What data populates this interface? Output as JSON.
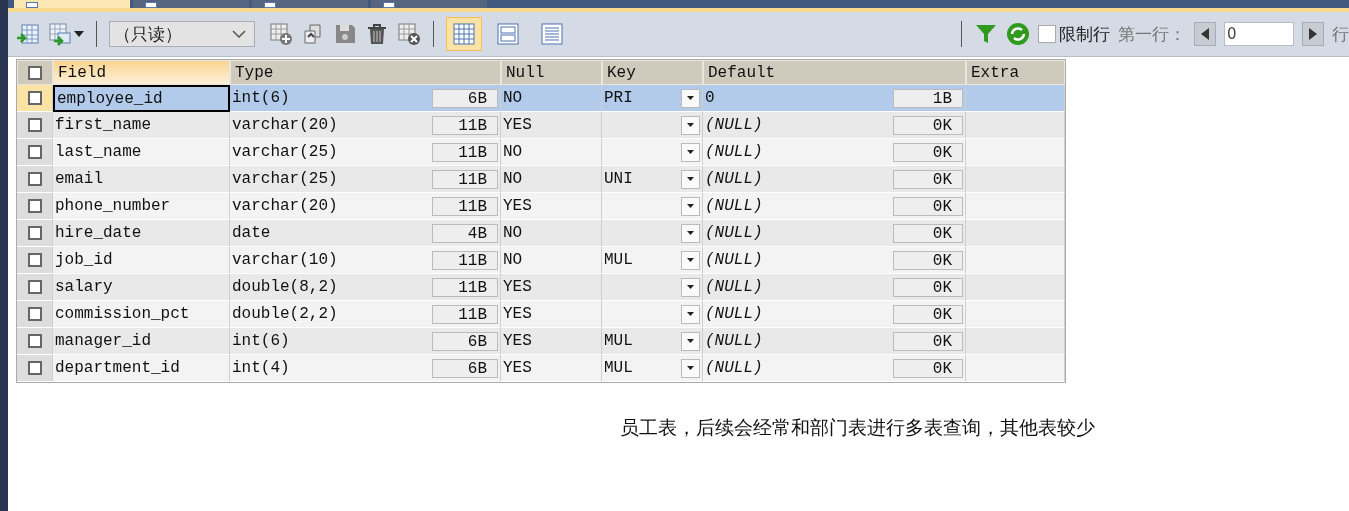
{
  "tabs": [
    {
      "selected": true
    },
    {
      "selected": false
    },
    {
      "selected": false
    },
    {
      "selected": false
    }
  ],
  "toolbar": {
    "mode_select": {
      "value": "（只读）"
    },
    "views": [
      {
        "selected": true
      },
      {
        "selected": false
      },
      {
        "selected": false
      }
    ],
    "limit_rows": {
      "label": "限制行",
      "checked": false
    },
    "first_row": {
      "label": "第一行：",
      "disabled": true,
      "value": "0"
    },
    "row_count_label": "行"
  },
  "table": {
    "select_all_checked": false,
    "columns": [
      "Field",
      "Type",
      "Null",
      "Key",
      "Default",
      "Extra"
    ],
    "rows": [
      {
        "checked": false,
        "selected": true,
        "field": "employee_id",
        "type": "int(6)",
        "type_size": "6B",
        "null": "NO",
        "key": "PRI",
        "default": "0",
        "default_is_null": false,
        "default_size": "1B"
      },
      {
        "checked": false,
        "selected": false,
        "field": "first_name",
        "type": "varchar(20)",
        "type_size": "11B",
        "null": "YES",
        "default": "(NULL)",
        "default_is_null": true,
        "default_size": "0K"
      },
      {
        "checked": false,
        "selected": false,
        "field": "last_name",
        "type": "varchar(25)",
        "type_size": "11B",
        "null": "NO",
        "default": "(NULL)",
        "default_is_null": true,
        "default_size": "0K"
      },
      {
        "checked": false,
        "selected": false,
        "field": "email",
        "type": "varchar(25)",
        "type_size": "11B",
        "null": "NO",
        "key": "UNI",
        "default": "(NULL)",
        "default_is_null": true,
        "default_size": "0K"
      },
      {
        "checked": false,
        "selected": false,
        "field": "phone_number",
        "type": "varchar(20)",
        "type_size": "11B",
        "null": "YES",
        "default": "(NULL)",
        "default_is_null": true,
        "default_size": "0K"
      },
      {
        "checked": false,
        "selected": false,
        "field": "hire_date",
        "type": "date",
        "type_size": "4B",
        "null": "NO",
        "default": "(NULL)",
        "default_is_null": true,
        "default_size": "0K"
      },
      {
        "checked": false,
        "selected": false,
        "field": "job_id",
        "type": "varchar(10)",
        "type_size": "11B",
        "null": "NO",
        "key": "MUL",
        "default": "(NULL)",
        "default_is_null": true,
        "default_size": "0K"
      },
      {
        "checked": false,
        "selected": false,
        "field": "salary",
        "type": "double(8,2)",
        "type_size": "11B",
        "null": "YES",
        "default": "(NULL)",
        "default_is_null": true,
        "default_size": "0K"
      },
      {
        "checked": false,
        "selected": false,
        "field": "commission_pct",
        "type": "double(2,2)",
        "type_size": "11B",
        "null": "YES",
        "default": "(NULL)",
        "default_is_null": true,
        "default_size": "0K"
      },
      {
        "checked": false,
        "selected": false,
        "field": "manager_id",
        "type": "int(6)",
        "type_size": "6B",
        "null": "YES",
        "key": "MUL",
        "default": "(NULL)",
        "default_is_null": true,
        "default_size": "0K"
      },
      {
        "checked": false,
        "selected": false,
        "field": "department_id",
        "type": "int(4)",
        "type_size": "6B",
        "null": "YES",
        "key": "MUL",
        "default": "(NULL)",
        "default_is_null": true,
        "default_size": "0K"
      }
    ]
  },
  "note": "员工表，后续会经常和部门表进行多表查询，其他表较少"
}
